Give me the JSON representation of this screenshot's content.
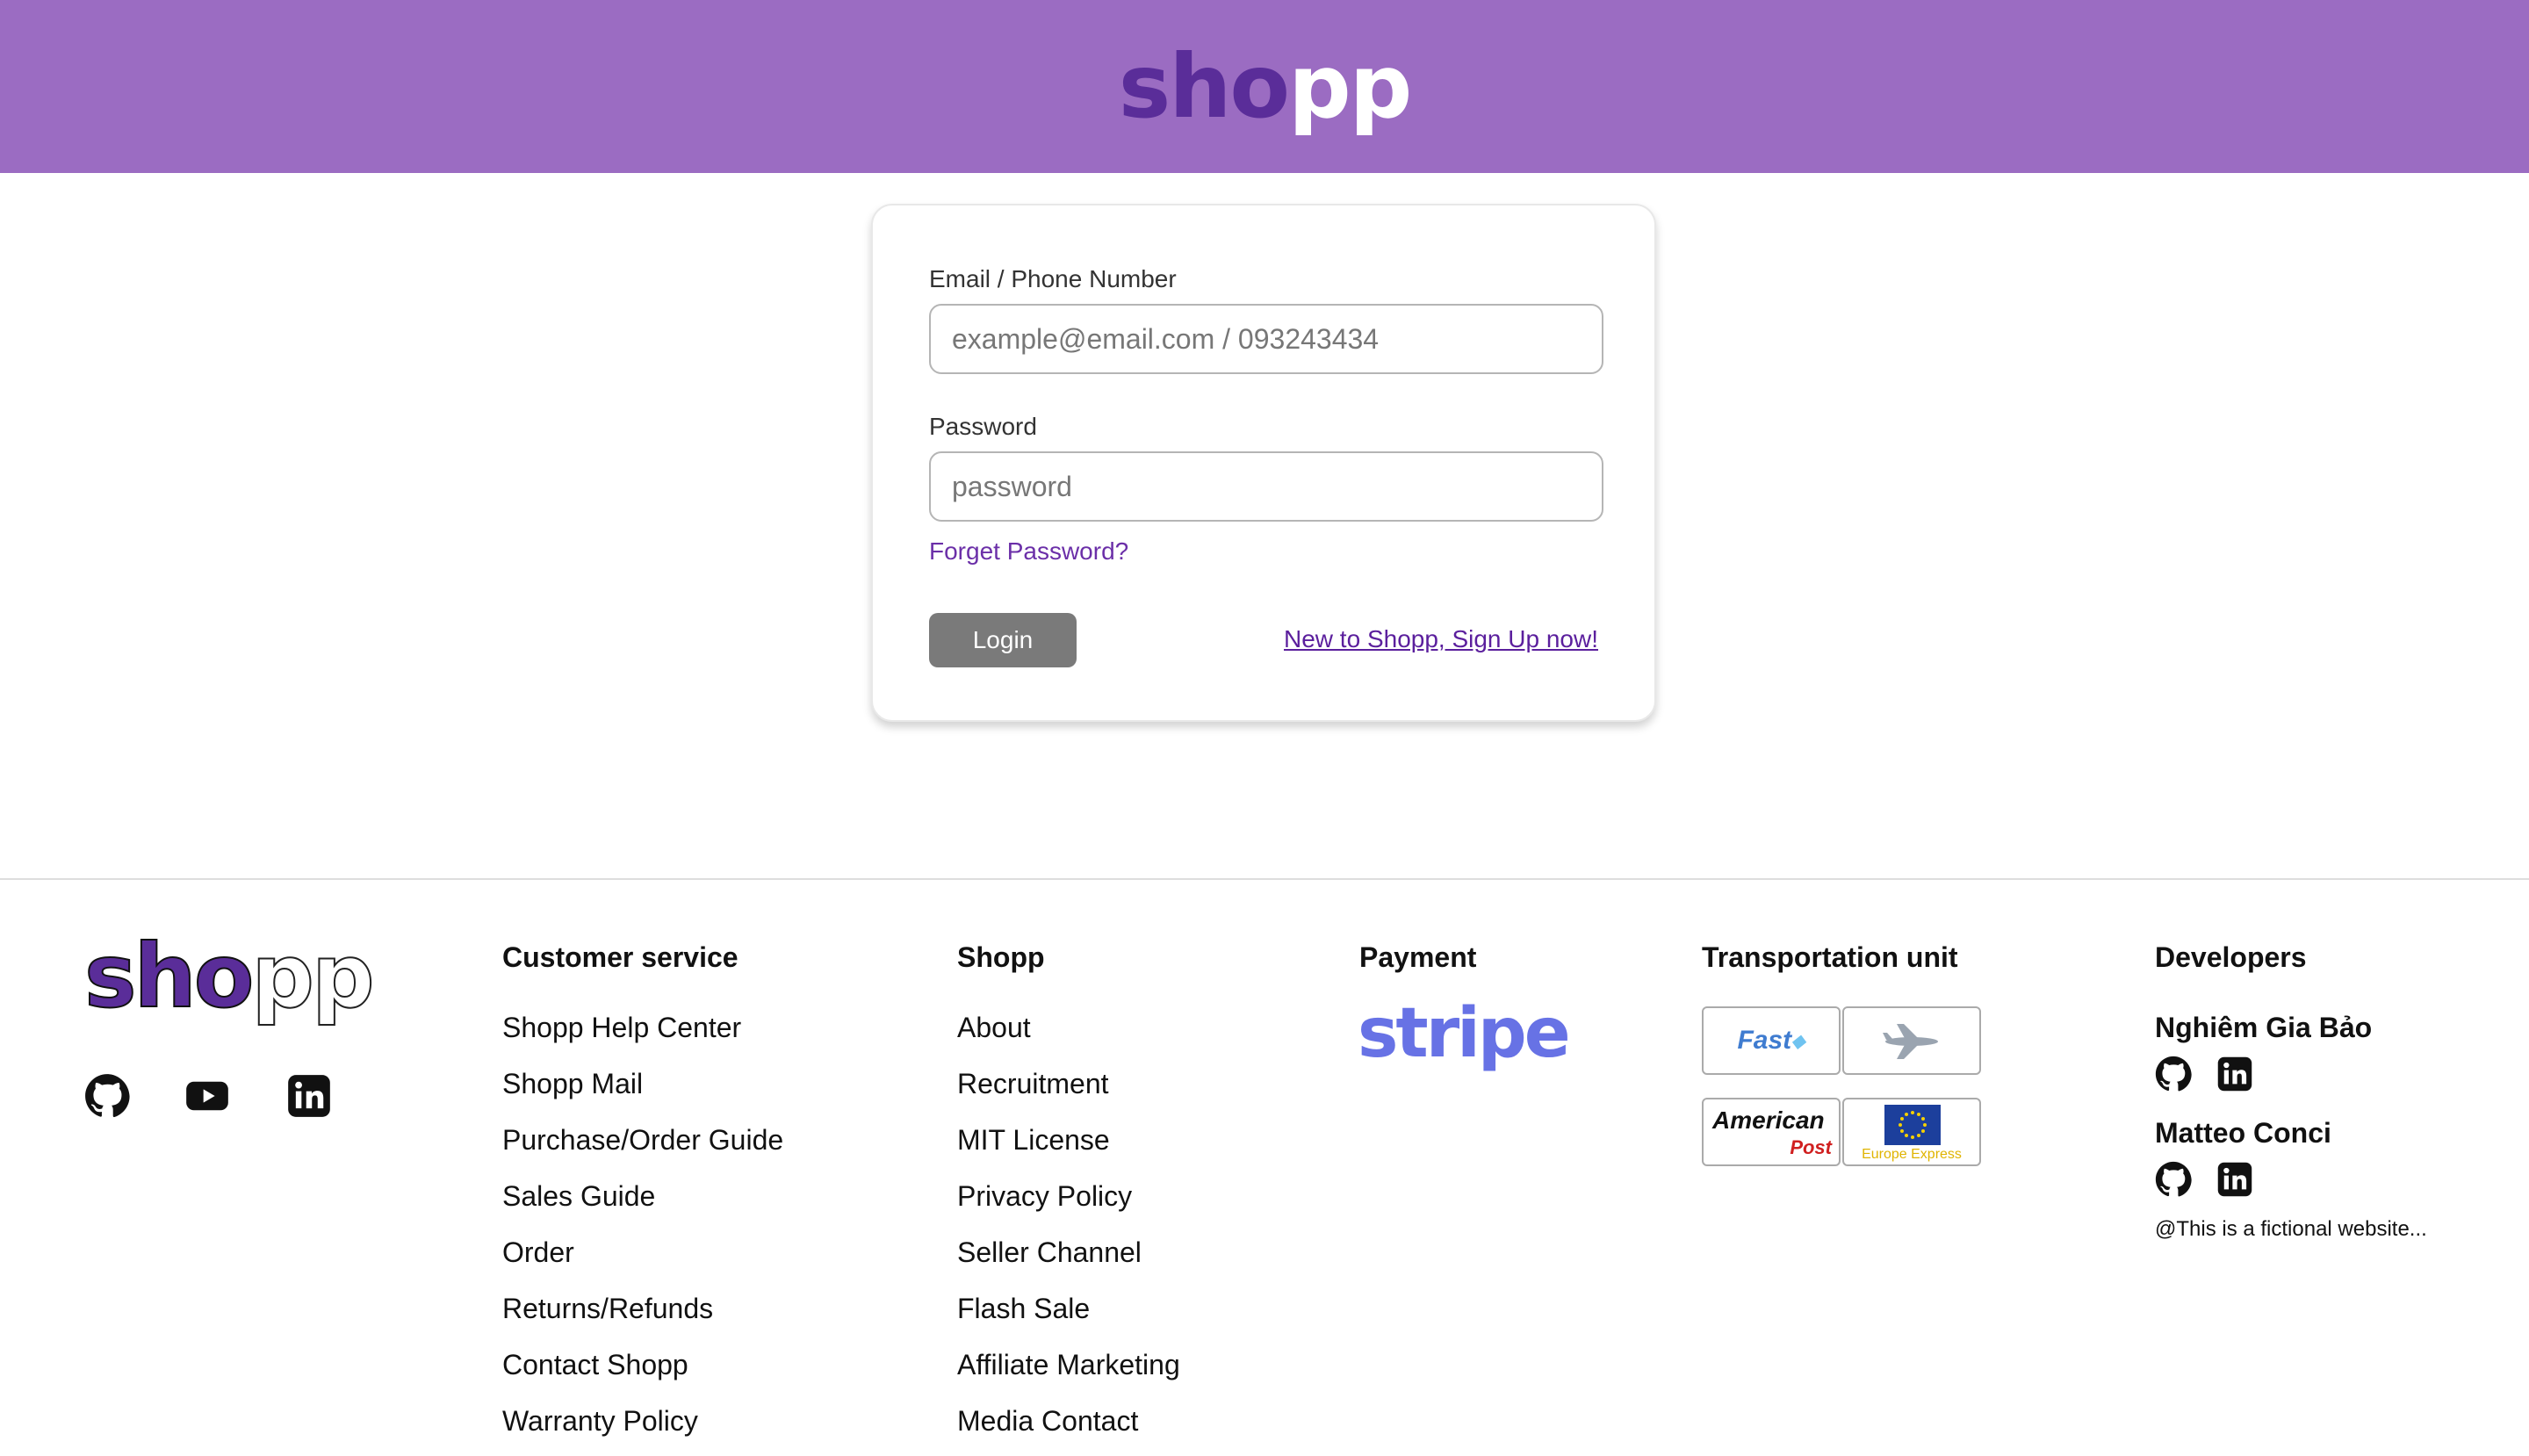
{
  "header": {
    "brand_part1": "sho",
    "brand_part2": "pp"
  },
  "login": {
    "email_label": "Email / Phone Number",
    "email_placeholder": "example@email.com / 093243434",
    "password_label": "Password",
    "password_placeholder": "password",
    "forgot_label": "Forget Password?",
    "login_label": "Login",
    "signup_label": "New to Shopp, Sign Up now!"
  },
  "footer": {
    "brand_part1": "sho",
    "brand_part2": "pp",
    "social_icons": [
      "github-icon",
      "youtube-icon",
      "linkedin-icon"
    ],
    "customer_service": {
      "title": "Customer service",
      "items": [
        "Shopp Help Center",
        "Shopp Mail",
        "Purchase/Order Guide",
        "Sales Guide",
        "Order",
        "Returns/Refunds",
        "Contact Shopp",
        "Warranty Policy"
      ]
    },
    "shopp": {
      "title": "Shopp",
      "items": [
        "About",
        "Recruitment",
        "MIT License",
        "Privacy Policy",
        "Seller Channel",
        "Flash Sale",
        "Affiliate Marketing",
        "Media Contact"
      ]
    },
    "payment": {
      "title": "Payment",
      "logo_text": "stripe"
    },
    "transport": {
      "title": "Transportation unit",
      "logos": [
        {
          "text": "Fast"
        },
        {
          "text": ""
        },
        {
          "text": "American",
          "subtext": "Post"
        },
        {
          "text": "Europe Express"
        }
      ]
    },
    "developers": {
      "title": "Developers",
      "people": [
        {
          "name": "Nghiêm Gia Bảo"
        },
        {
          "name": "Matteo Conci"
        }
      ],
      "note": "@This is a fictional website..."
    }
  },
  "colors": {
    "header_bg": "#9b6cc2",
    "brand_dark": "#5a2d99",
    "link": "#6b2fa8",
    "stripe": "#6772e5",
    "button": "#7a7a7a"
  }
}
